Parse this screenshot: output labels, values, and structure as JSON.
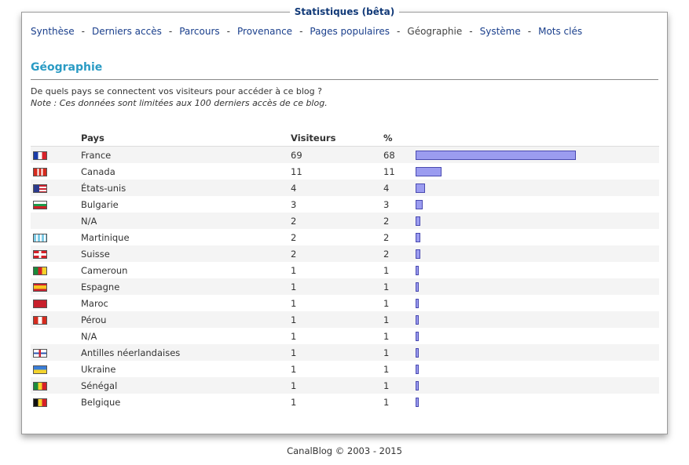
{
  "panel": {
    "title": "Statistiques (bêta)"
  },
  "nav": {
    "items": [
      {
        "label": "Synthèse",
        "active": false
      },
      {
        "label": "Derniers accès",
        "active": false
      },
      {
        "label": "Parcours",
        "active": false
      },
      {
        "label": "Provenance",
        "active": false
      },
      {
        "label": "Pages populaires",
        "active": false
      },
      {
        "label": "Géographie",
        "active": true
      },
      {
        "label": "Système",
        "active": false
      },
      {
        "label": "Mots clés",
        "active": false
      }
    ],
    "separator": "-"
  },
  "section": {
    "title": "Géographie",
    "question": "De quels pays se connectent vos visiteurs pour accéder à ce blog ?",
    "note": "Note : Ces données sont limitées aux 100 derniers accès de ce blog."
  },
  "table": {
    "headers": {
      "country": "Pays",
      "visitors": "Visiteurs",
      "percent": "%"
    },
    "rows": [
      {
        "flag": "france-flag-icon",
        "country": "France",
        "visitors": "69",
        "percent": "68",
        "share": 68
      },
      {
        "flag": "canada-flag-icon",
        "country": "Canada",
        "visitors": "11",
        "percent": "11",
        "share": 11
      },
      {
        "flag": "usa-flag-icon",
        "country": "États-unis",
        "visitors": "4",
        "percent": "4",
        "share": 4
      },
      {
        "flag": "bulgaria-flag-icon",
        "country": "Bulgarie",
        "visitors": "3",
        "percent": "3",
        "share": 3
      },
      {
        "flag": "",
        "country": "N/A",
        "visitors": "2",
        "percent": "2",
        "share": 2
      },
      {
        "flag": "martinique-flag-icon",
        "country": "Martinique",
        "visitors": "2",
        "percent": "2",
        "share": 2
      },
      {
        "flag": "switzerland-flag-icon",
        "country": "Suisse",
        "visitors": "2",
        "percent": "2",
        "share": 2
      },
      {
        "flag": "cameroon-flag-icon",
        "country": "Cameroun",
        "visitors": "1",
        "percent": "1",
        "share": 1
      },
      {
        "flag": "spain-flag-icon",
        "country": "Espagne",
        "visitors": "1",
        "percent": "1",
        "share": 1
      },
      {
        "flag": "morocco-flag-icon",
        "country": "Maroc",
        "visitors": "1",
        "percent": "1",
        "share": 1
      },
      {
        "flag": "peru-flag-icon",
        "country": "Pérou",
        "visitors": "1",
        "percent": "1",
        "share": 1
      },
      {
        "flag": "",
        "country": "N/A",
        "visitors": "1",
        "percent": "1",
        "share": 1
      },
      {
        "flag": "netherlands-antilles-flag-icon",
        "country": "Antilles néerlandaises",
        "visitors": "1",
        "percent": "1",
        "share": 1
      },
      {
        "flag": "ukraine-flag-icon",
        "country": "Ukraine",
        "visitors": "1",
        "percent": "1",
        "share": 1
      },
      {
        "flag": "senegal-flag-icon",
        "country": "Sénégal",
        "visitors": "1",
        "percent": "1",
        "share": 1
      },
      {
        "flag": "belgium-flag-icon",
        "country": "Belgique",
        "visitors": "1",
        "percent": "1",
        "share": 1
      }
    ]
  },
  "colors": {
    "bar": "#9b9cf0",
    "link": "#1a3f8c",
    "title": "#2a9bc4"
  },
  "footer": {
    "text": "CanalBlog © 2003 - 2015"
  }
}
